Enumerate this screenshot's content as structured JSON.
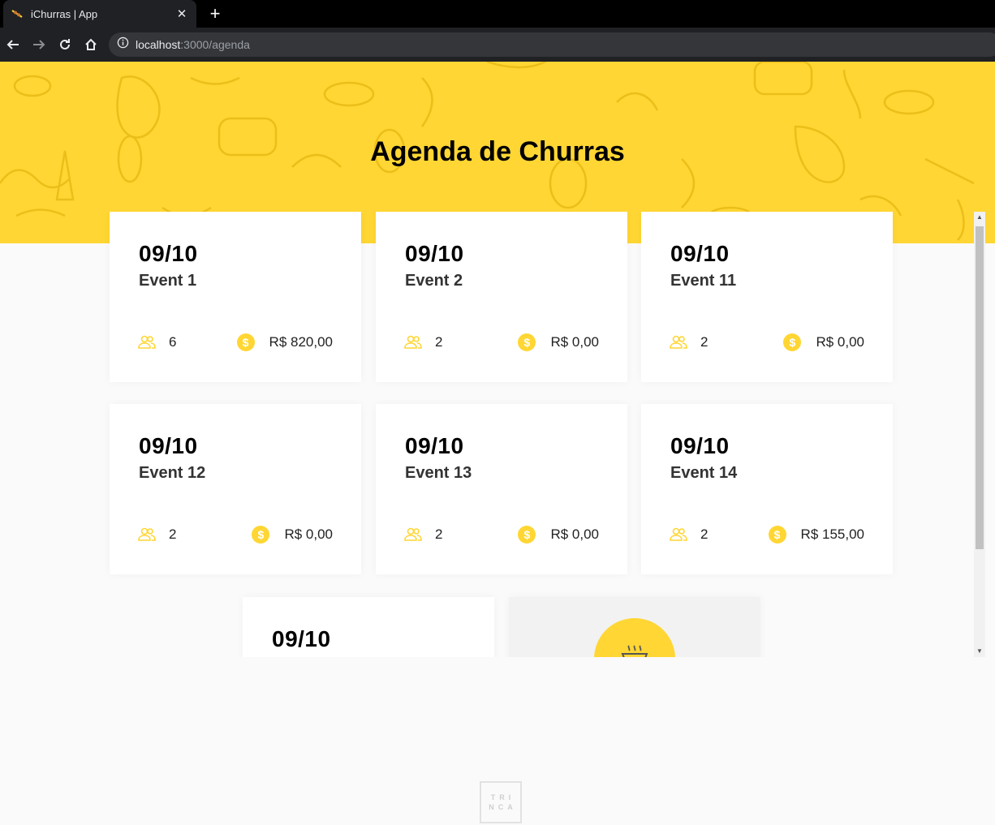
{
  "browser": {
    "tab_title": "iChurras | App",
    "url_host": "localhost",
    "url_path": ":3000/agenda"
  },
  "page": {
    "title": "Agenda de Churras"
  },
  "events": [
    {
      "date": "09/10",
      "name": "Event 1",
      "people": "6",
      "amount": "R$ 820,00"
    },
    {
      "date": "09/10",
      "name": "Event 2",
      "people": "2",
      "amount": "R$ 0,00"
    },
    {
      "date": "09/10",
      "name": "Event 11",
      "people": "2",
      "amount": "R$ 0,00"
    },
    {
      "date": "09/10",
      "name": "Event 12",
      "people": "2",
      "amount": "R$ 0,00"
    },
    {
      "date": "09/10",
      "name": "Event 13",
      "people": "2",
      "amount": "R$ 0,00"
    },
    {
      "date": "09/10",
      "name": "Event 14",
      "people": "2",
      "amount": "R$ 155,00"
    },
    {
      "date": "09/10"
    }
  ],
  "footer": {
    "logo_line1": "TRI",
    "logo_line2": "NCA"
  },
  "colors": {
    "accent": "#ffd633",
    "background": "#fafafa",
    "card": "#ffffff"
  }
}
